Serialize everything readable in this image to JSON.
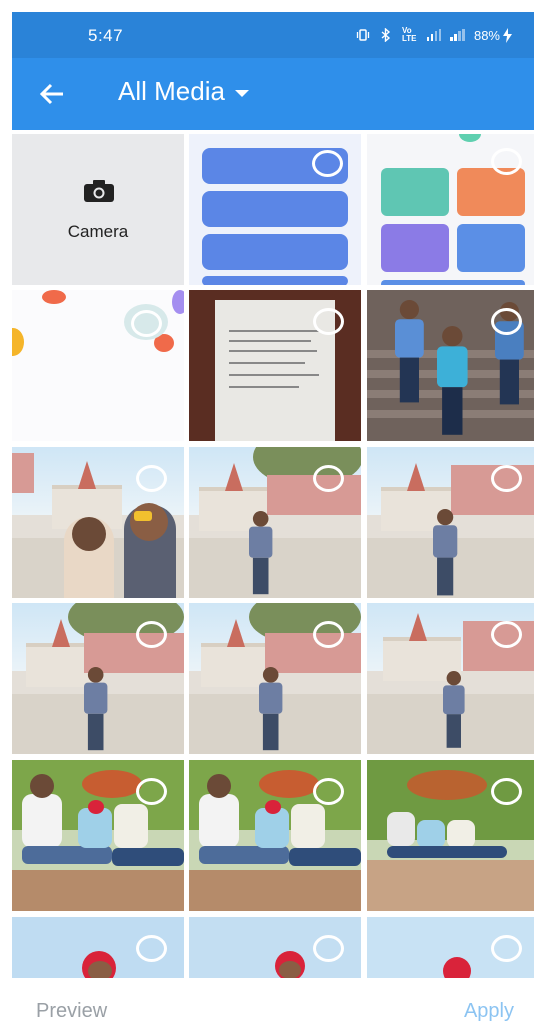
{
  "status_bar": {
    "time": "5:47",
    "icons": [
      "vibrate-icon",
      "bluetooth-icon",
      "volte-icon",
      "signal-icon",
      "signal-icon"
    ],
    "volte_label": "Vo LTE",
    "battery": "88%"
  },
  "app_bar": {
    "title": "All Media",
    "back_icon": "arrow-left-icon",
    "dropdown_icon": "caret-down-icon"
  },
  "grid": {
    "camera_label": "Camera",
    "items": [
      {
        "name": "camera-tile"
      },
      {
        "name": "screenshot-app-menu"
      },
      {
        "name": "screenshot-app-tools"
      },
      {
        "name": "screenshot-colorful"
      },
      {
        "name": "photo-document"
      },
      {
        "name": "photo-two-men-stairs"
      },
      {
        "name": "photo-selfie-temple"
      },
      {
        "name": "photo-man-temple-1"
      },
      {
        "name": "photo-man-temple-2"
      },
      {
        "name": "photo-man-temple-3"
      },
      {
        "name": "photo-man-temple-4"
      },
      {
        "name": "photo-man-temple-5"
      },
      {
        "name": "photo-group-sitting-1"
      },
      {
        "name": "photo-group-sitting-2"
      },
      {
        "name": "photo-group-sitting-3"
      },
      {
        "name": "photo-portrait-1"
      },
      {
        "name": "photo-portrait-2"
      },
      {
        "name": "photo-portrait-3"
      }
    ]
  },
  "bottom_bar": {
    "preview_label": "Preview",
    "apply_label": "Apply"
  },
  "colors": {
    "status_bar": "#2a83d8",
    "app_bar": "#2f8fea",
    "bottom_text": "#9aa0a6",
    "apply_text": "#8cc4f2"
  }
}
